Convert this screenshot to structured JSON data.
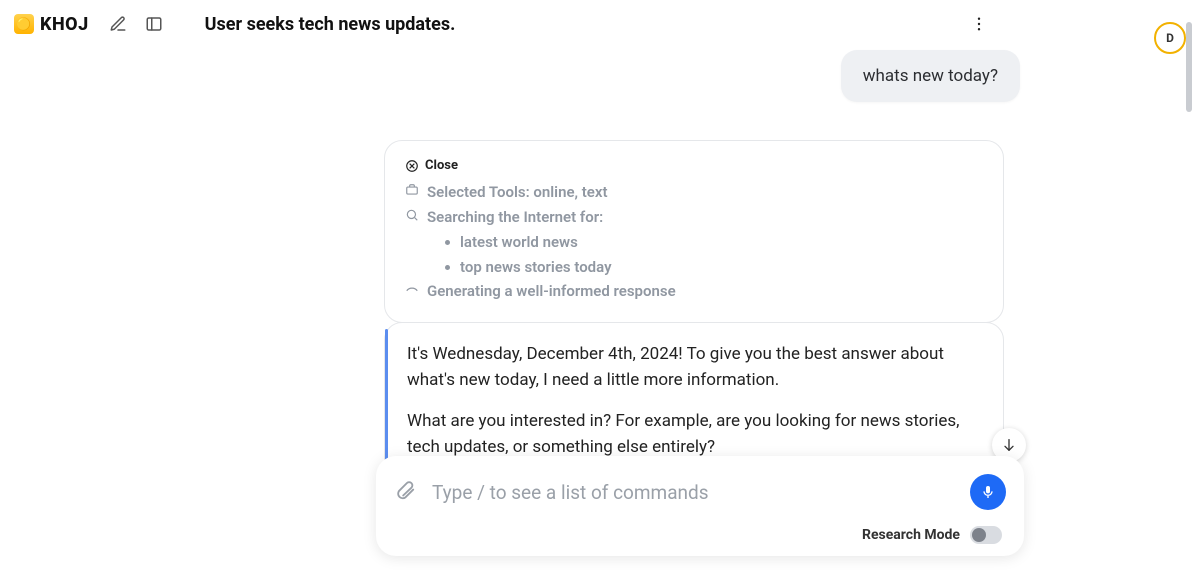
{
  "header": {
    "brand": "KHOJ",
    "title": "User seeks tech news updates.",
    "avatar_initial": "D"
  },
  "user_message": "whats new today?",
  "thinking": {
    "close_label": "Close",
    "tools_label": "Selected Tools: online, text",
    "searching_label": "Searching the Internet for:",
    "search_terms": {
      "t0": "latest world news",
      "t1": "top news stories today"
    },
    "generating_label": "Generating a well-informed response"
  },
  "assistant": {
    "p1": "It's Wednesday, December 4th, 2024! To give you the best answer about what's new today, I need a little more information.",
    "p2": "What are you interested in? For example, are you looking for news stories, tech updates, or something else entirely?"
  },
  "composer": {
    "placeholder": "Type / to see a list of commands",
    "research_label": "Research Mode"
  }
}
